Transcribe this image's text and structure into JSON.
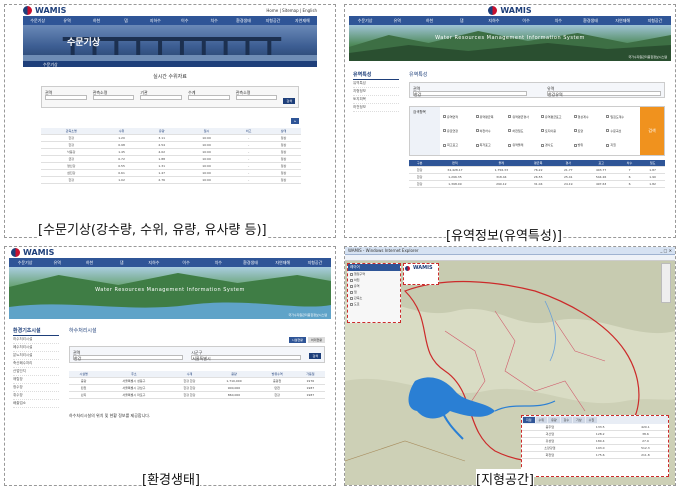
{
  "panels": {
    "p1": {
      "caption": "[수문기상(강수량, 수위, 유량, 유사량 등)]",
      "logo": "WAMIS",
      "nav": [
        "수문기상",
        "유역",
        "하천",
        "댐",
        "지하수",
        "이수",
        "치수",
        "환경생태",
        "지형공간",
        "자연재해"
      ],
      "banner_title": "수문기상",
      "page_title": "실시간 수위자료",
      "search_button": "검색",
      "filters": [
        "권역",
        "관측소명",
        "기관",
        "수계",
        "관측소명"
      ],
      "table_headers": [
        "관측소명",
        "수위",
        "유량",
        "일시",
        "비고",
        "상태"
      ],
      "rows": [
        [
          "한강",
          "1.20",
          "3.11",
          "10:00",
          "-",
          "정상"
        ],
        [
          "한강",
          "0.98",
          "2.54",
          "10:00",
          "-",
          "정상"
        ],
        [
          "낙동강",
          "1.45",
          "4.02",
          "10:00",
          "-",
          "정상"
        ],
        [
          "금강",
          "0.72",
          "1.88",
          "10:00",
          "-",
          "정상"
        ],
        [
          "영산강",
          "0.55",
          "1.31",
          "10:00",
          "-",
          "정상"
        ],
        [
          "섬진강",
          "0.61",
          "1.47",
          "10:00",
          "-",
          "정상"
        ],
        [
          "한강",
          "1.02",
          "2.76",
          "10:00",
          "-",
          "정상"
        ]
      ]
    },
    "p2": {
      "caption": "[유역정보(유역특성)]",
      "logo": "WAMIS",
      "nav": [
        "수문기상",
        "유역",
        "하천",
        "댐",
        "지하수",
        "이수",
        "치수",
        "환경생태",
        "자연재해",
        "지형공간"
      ],
      "hero_title": "Water Resources Management Information System",
      "hero_sub": "국가수자원관리종합정보시스템",
      "side_title": "유역특성",
      "side_items": [
        "유역특성",
        "지형정보",
        "토지피복",
        "하천정보"
      ],
      "section_title": "유역특성",
      "fields": [
        "권역",
        "유역"
      ],
      "field_values": [
        "한강",
        "한강유역"
      ],
      "checkbox_title": "검색항목",
      "checkboxes": [
        "유역면적",
        "유역평균폭",
        "유역평균경사",
        "유역평균표고",
        "형상계수",
        "밀집도계수",
        "유로연장",
        "하천차수",
        "하천밀도",
        "토지이용",
        "토양",
        "수문곡선",
        "최고표고",
        "최저표고",
        "유역둘레",
        "경사도",
        "방위",
        "지질"
      ],
      "search_button": "검색",
      "table_headers": [
        "구분",
        "면적",
        "둘레",
        "평균폭",
        "경사",
        "표고",
        "차수",
        "밀도"
      ],
      "rows": [
        [
          "한강",
          "34,428.17",
          "1,756.33",
          "76.22",
          "21.77",
          "403.77",
          "7",
          "1.87"
        ],
        [
          "한강",
          "1,296.35",
          "318.44",
          "26.55",
          "25.41",
          "544.26",
          "6",
          "1.90"
        ],
        [
          "한강",
          "1,398.09",
          "290.12",
          "31.04",
          "24.19",
          "497.63",
          "6",
          "1.82"
        ]
      ]
    },
    "p3": {
      "caption": "[환경생태]",
      "logo": "WAMIS",
      "nav": [
        "수문기상",
        "유역",
        "하천",
        "댐",
        "지하수",
        "이수",
        "치수",
        "환경생태",
        "자연재해",
        "지형공간"
      ],
      "hero_title": "Water Resources Management Information System",
      "hero_sub": "국가수자원관리종합정보시스템",
      "side_title": "환경기초시설",
      "side_items": [
        "하수처리시설",
        "폐수처리시설",
        "분뇨처리시설",
        "축산폐수처리",
        "산업단지",
        "매립장",
        "정수장",
        "취수장",
        "배출업소"
      ],
      "section_title": "하수처리시설",
      "tab_labels": [
        "시설현황",
        "처리현황"
      ],
      "fields": [
        "권역",
        "시군구"
      ],
      "field_values": [
        "한강",
        "서울특별시"
      ],
      "search_button": "검색",
      "table_headers": [
        "시설명",
        "주소",
        "수계",
        "용량",
        "방류수역",
        "가동일"
      ],
      "rows": [
        [
          "중랑",
          "서울특별시 성동구",
          "한강 한강",
          "1,710,000",
          "중랑천",
          "1976"
        ],
        [
          "탄천",
          "서울특별시 강남구",
          "한강 한강",
          "900,000",
          "탄천",
          "1987"
        ],
        [
          "난지",
          "서울특별시 마포구",
          "한강 한강",
          "860,000",
          "한강",
          "1987"
        ]
      ],
      "note": "하수처리시설의 위치 및 현황 정보를 제공합니다."
    },
    "p4": {
      "caption": "[지형공간]",
      "window_title": "WAMIS - Windows Internet Explorer",
      "logo": "WAMIS",
      "layer_panel_title": "레이어",
      "layer_items": [
        "행정구역",
        "하천",
        "유역",
        "댐",
        "관측소",
        "도로"
      ],
      "result_tabs": [
        "지점",
        "수위",
        "유량",
        "강수",
        "기상",
        "수질"
      ],
      "result_rows": [
        [
          "충주댐",
          "133.5",
          "420.1"
        ],
        [
          "괴산댐",
          "128.2",
          "38.6"
        ],
        [
          "횡성댐",
          "180.4",
          "27.9"
        ],
        [
          "소양강댐",
          "193.0",
          "512.3"
        ],
        [
          "화천댐",
          "175.6",
          "211.8"
        ]
      ]
    }
  },
  "colors": {
    "nav": "#2f5597",
    "accent_orange": "#f0921e",
    "water": "#2a7fd4",
    "dashed_red": "#cc2a2a"
  }
}
